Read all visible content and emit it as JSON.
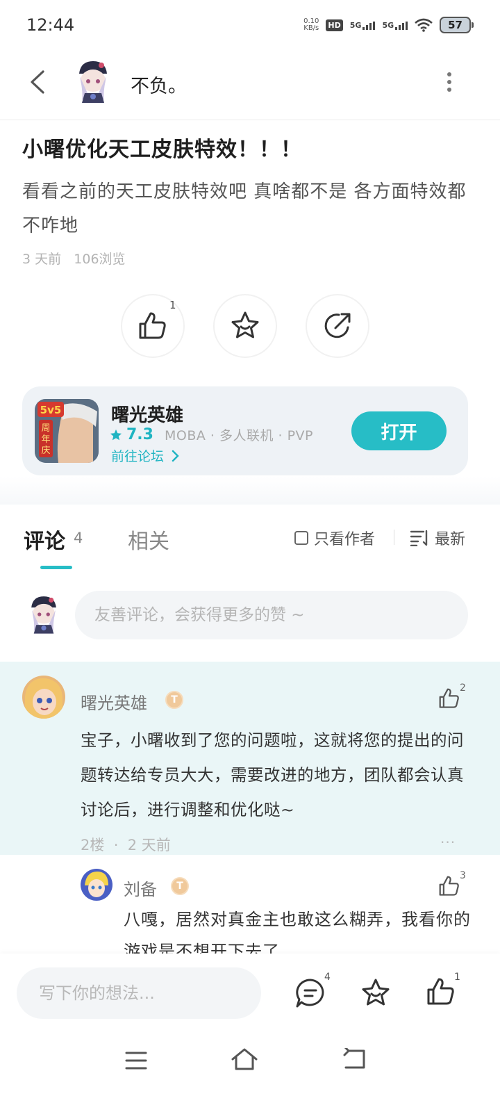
{
  "status_bar": {
    "time": "12:44",
    "speed_value": "0.10",
    "speed_unit": "KB/s",
    "hd_label": "HD",
    "net1": "5G",
    "net2": "5G",
    "battery": "57"
  },
  "header": {
    "username": "不负。",
    "icons": [
      "back-icon",
      "more-icon"
    ]
  },
  "post": {
    "title": "小曙优化天工皮肤特效！！！",
    "body": "看看之前的天工皮肤特效吧   真啥都不是   各方面特效都不咋地",
    "time": "3 天前",
    "views": "106浏览",
    "like_count": "1"
  },
  "game_card": {
    "name": "曙光英雄",
    "rating": "7.3",
    "tags": "MOBA  ·  多人联机  ·  PVP",
    "forum_link": "前往论坛",
    "open_button": "打开",
    "accent_color": "#27bdc6"
  },
  "tabs": {
    "comments_label": "评论",
    "comments_count": "4",
    "related_label": "相关",
    "author_only": "只看作者",
    "sort": "最新"
  },
  "comment_input": {
    "placeholder": "友善评论，会获得更多的赞 ~"
  },
  "comments": [
    {
      "author": "曙光英雄",
      "badge": "T",
      "likes": "2",
      "text": "宝子，小曙收到了您的问题啦，这就将您的提出的问题转达给专员大大，需要改进的地方，团队都会认真讨论后，进行调整和优化哒~",
      "floor": "2楼",
      "time": "2 天前",
      "more": "···"
    }
  ],
  "reply": {
    "author": "刘备",
    "badge": "T",
    "likes": "3",
    "text": "八嘎，居然对真金主也敢这么糊弄，我看你的游戏是不想开下去了"
  },
  "bottom_bar": {
    "placeholder": "写下你的想法...",
    "comment_count": "4",
    "like_count": "1"
  }
}
